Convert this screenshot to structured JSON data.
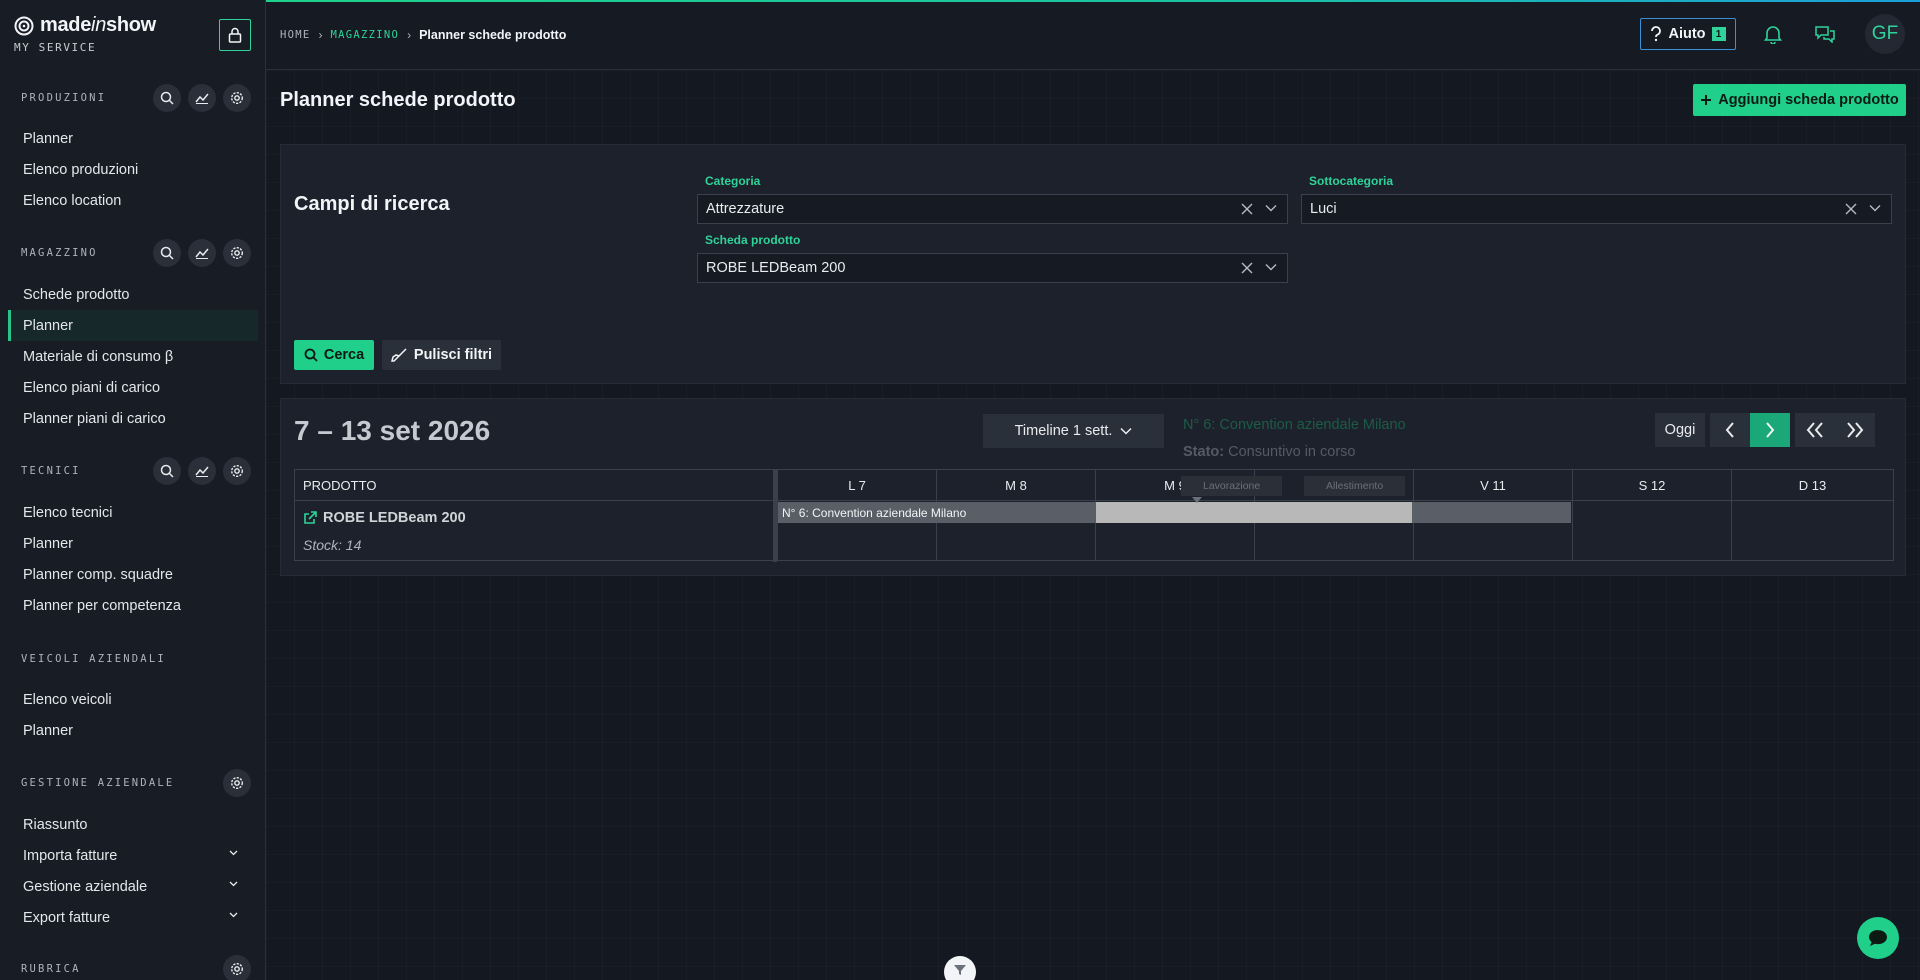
{
  "brand": {
    "name_main": "made",
    "name_italic": "in",
    "name_tail": "show",
    "subtitle": "MY SERVICE"
  },
  "sidebar": {
    "sections": [
      {
        "title": "PRODUZIONI",
        "items": [
          "Planner",
          "Elenco produzioni",
          "Elenco location"
        ]
      },
      {
        "title": "MAGAZZINO",
        "items": [
          "Schede prodotto",
          "Planner",
          "Materiale di consumo β",
          "Elenco piani di carico",
          "Planner piani di carico"
        ],
        "active_index": 1
      },
      {
        "title": "TECNICI",
        "items": [
          "Elenco tecnici",
          "Planner",
          "Planner comp. squadre",
          "Planner per competenza"
        ]
      },
      {
        "title": "VEICOLI AZIENDALI",
        "items": [
          "Elenco veicoli",
          "Planner"
        ]
      },
      {
        "title": "GESTIONE AZIENDALE",
        "items": [
          "Riassunto",
          "Importa fatture",
          "Gestione aziendale",
          "Export fatture"
        ]
      },
      {
        "title": "RUBRICA",
        "items": []
      }
    ]
  },
  "breadcrumb": {
    "home": "HOME",
    "section": "MAGAZZINO",
    "current": "Planner schede prodotto"
  },
  "topbar": {
    "help_label": "Aiuto",
    "help_badge": "1",
    "avatar_initials": "GF"
  },
  "page": {
    "title": "Planner schede prodotto",
    "add_button": "Aggiungi scheda prodotto"
  },
  "search": {
    "title": "Campi di ricerca",
    "categoria_label": "Categoria",
    "categoria_value": "Attrezzature",
    "sottocategoria_label": "Sottocategoria",
    "sottocategoria_value": "Luci",
    "scheda_label": "Scheda prodotto",
    "scheda_value": "ROBE LEDBeam 200",
    "search_button": "Cerca",
    "clear_button": "Pulisci filtri"
  },
  "planner": {
    "range": "7 – 13 set 2026",
    "view_label": "Timeline 1 sett.",
    "tooltip_title": "N° 6: Convention aziendale Milano",
    "tooltip_state_label": "Stato:",
    "tooltip_state_value": "Consuntivo in corso",
    "today_button": "Oggi",
    "product_header": "PRODOTTO",
    "days": [
      "L 7",
      "M 8",
      "M 9",
      "G 10",
      "V 11",
      "S 12",
      "D 13"
    ],
    "ghost_tags": [
      "Lavorazione",
      "Allestimento"
    ],
    "rows": [
      {
        "product": "ROBE LEDBeam 200",
        "stock": "Stock: 14",
        "booking": "N° 6: Convention aziendale Milano"
      }
    ]
  },
  "colors": {
    "accent": "#1fcf8a",
    "bg": "#141820",
    "sidebar_bg": "#181c24",
    "help_border": "#3a8fd6"
  }
}
